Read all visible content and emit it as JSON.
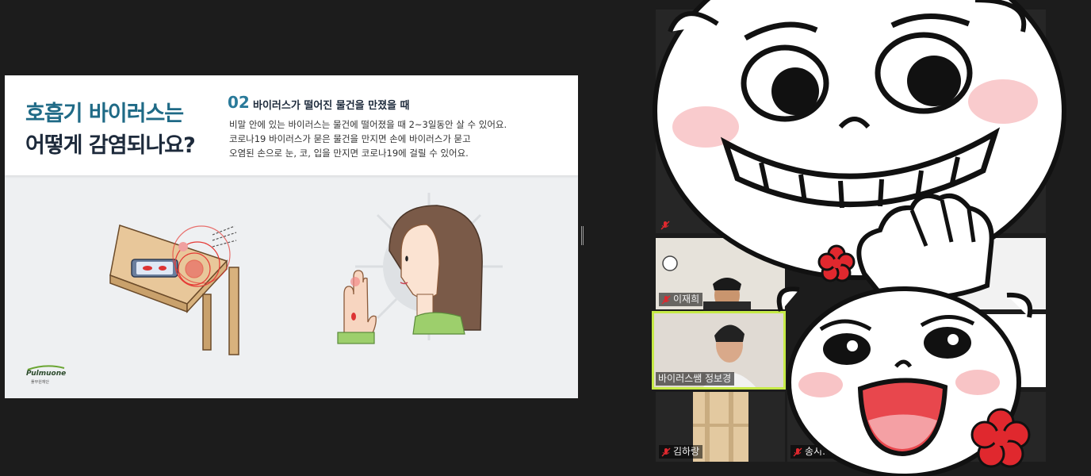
{
  "slide": {
    "title_line1": "호흡기 바이러스는",
    "title_line2": "어떻게 감염되나요?",
    "section_number": "02",
    "section_heading": "바이러스가 떨어진 물건을 만졌을 때",
    "body": [
      "비말 안에 있는 바이러스는 물건에 떨어졌을 때 2~3일동안 살 수 있어요.",
      "코로나19 바이러스가 묻은 물건을 만지면 손에 바이러스가 묻고",
      "오염된 손으로 눈, 코, 입을 만지면 코로나19에 걸릴 수 있어요."
    ],
    "brand": "Pulmuone",
    "brand_sub": "풀무원재단"
  },
  "gallery": {
    "participants": [
      {
        "name": "이재희",
        "muted": true,
        "active": false
      },
      {
        "name": "바이러스쌤 정보경",
        "muted": false,
        "active": true
      },
      {
        "name": "김하랑",
        "muted": true,
        "active": false
      },
      {
        "name": "송시...",
        "muted": true,
        "active": false
      }
    ]
  },
  "colors": {
    "active_border": "#c6ea47",
    "title_teal": "#1f6a86",
    "title_navy": "#1d2a3b",
    "muted_red": "#e0282e",
    "virus_red": "#e53935"
  }
}
